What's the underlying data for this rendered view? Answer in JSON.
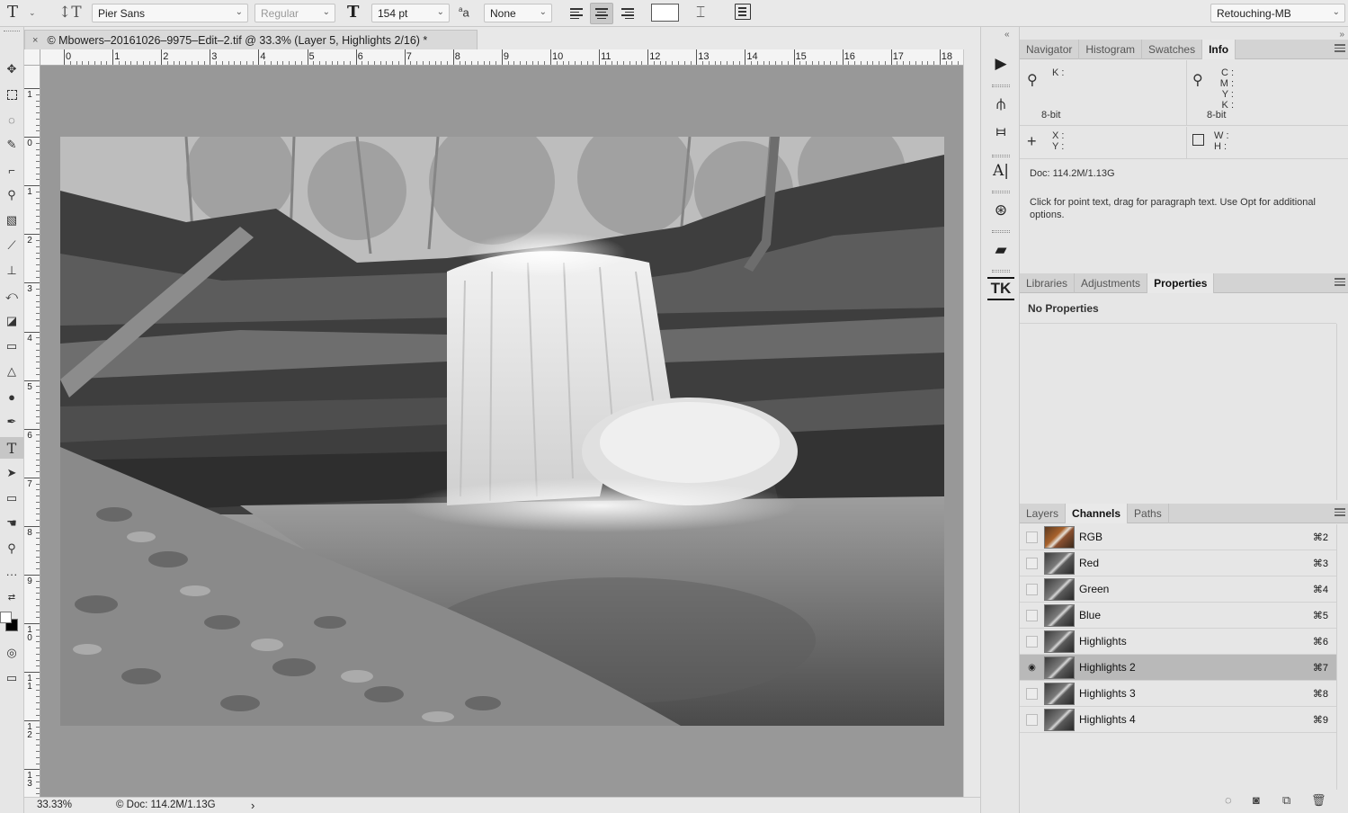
{
  "options_bar": {
    "font_family": "Pier Sans",
    "font_style": "Regular",
    "font_size": "154 pt",
    "aa_label": "a",
    "antialias": "None",
    "workspace": "Retouching-MB"
  },
  "document": {
    "tab_title": "© Mbowers–20161026–9975–Edit–2.tif @ 33.3% (Layer 5, Highlights 2/16) *",
    "close": "×",
    "zoom": "33.33%",
    "status": "© Doc: 114.2M/1.13G",
    "status_arrow": "›"
  },
  "rulers": {
    "h_labels": [
      "0",
      "1",
      "2",
      "3",
      "4",
      "5",
      "6",
      "7",
      "8",
      "9",
      "10",
      "11",
      "12",
      "13",
      "14",
      "15",
      "16",
      "17",
      "18"
    ],
    "v_labels": [
      "1",
      "0",
      "1",
      "2",
      "3",
      "4",
      "5",
      "6",
      "7",
      "8",
      "9",
      "1 0",
      "1 1",
      "1 2",
      "1 3"
    ]
  },
  "info_panel": {
    "tabs": [
      "Navigator",
      "Histogram",
      "Swatches",
      "Info"
    ],
    "active_tab": "Info",
    "k_label": "K :",
    "cmyk_labels": [
      "C :",
      "M :",
      "Y :",
      "K :"
    ],
    "bit_left": "8-bit",
    "bit_right": "8-bit",
    "xy_labels": [
      "X :",
      "Y :"
    ],
    "wh_labels": [
      "W :",
      "H :"
    ],
    "doc_size": "Doc: 114.2M/1.13G",
    "hint": "Click for point text, drag for paragraph text. Use Opt for additional options."
  },
  "properties_panel": {
    "tabs": [
      "Libraries",
      "Adjustments",
      "Properties"
    ],
    "active_tab": "Properties",
    "empty_label": "No Properties"
  },
  "channels_panel": {
    "tabs": [
      "Layers",
      "Channels",
      "Paths"
    ],
    "active_tab": "Channels",
    "channels": [
      {
        "name": "RGB",
        "shortcut": "⌘2",
        "visible": false,
        "selected": false,
        "color": true
      },
      {
        "name": "Red",
        "shortcut": "⌘3",
        "visible": false,
        "selected": false,
        "color": false
      },
      {
        "name": "Green",
        "shortcut": "⌘4",
        "visible": false,
        "selected": false,
        "color": false
      },
      {
        "name": "Blue",
        "shortcut": "⌘5",
        "visible": false,
        "selected": false,
        "color": false
      },
      {
        "name": "Highlights",
        "shortcut": "⌘6",
        "visible": false,
        "selected": false,
        "color": false
      },
      {
        "name": "Highlights 2",
        "shortcut": "⌘7",
        "visible": true,
        "selected": true,
        "color": false
      },
      {
        "name": "Highlights 3",
        "shortcut": "⌘8",
        "visible": false,
        "selected": false,
        "color": false
      },
      {
        "name": "Highlights 4",
        "shortcut": "⌘9",
        "visible": false,
        "selected": false,
        "color": false
      }
    ]
  },
  "dock": {
    "tk_label": "TK",
    "type_label": "A|"
  }
}
